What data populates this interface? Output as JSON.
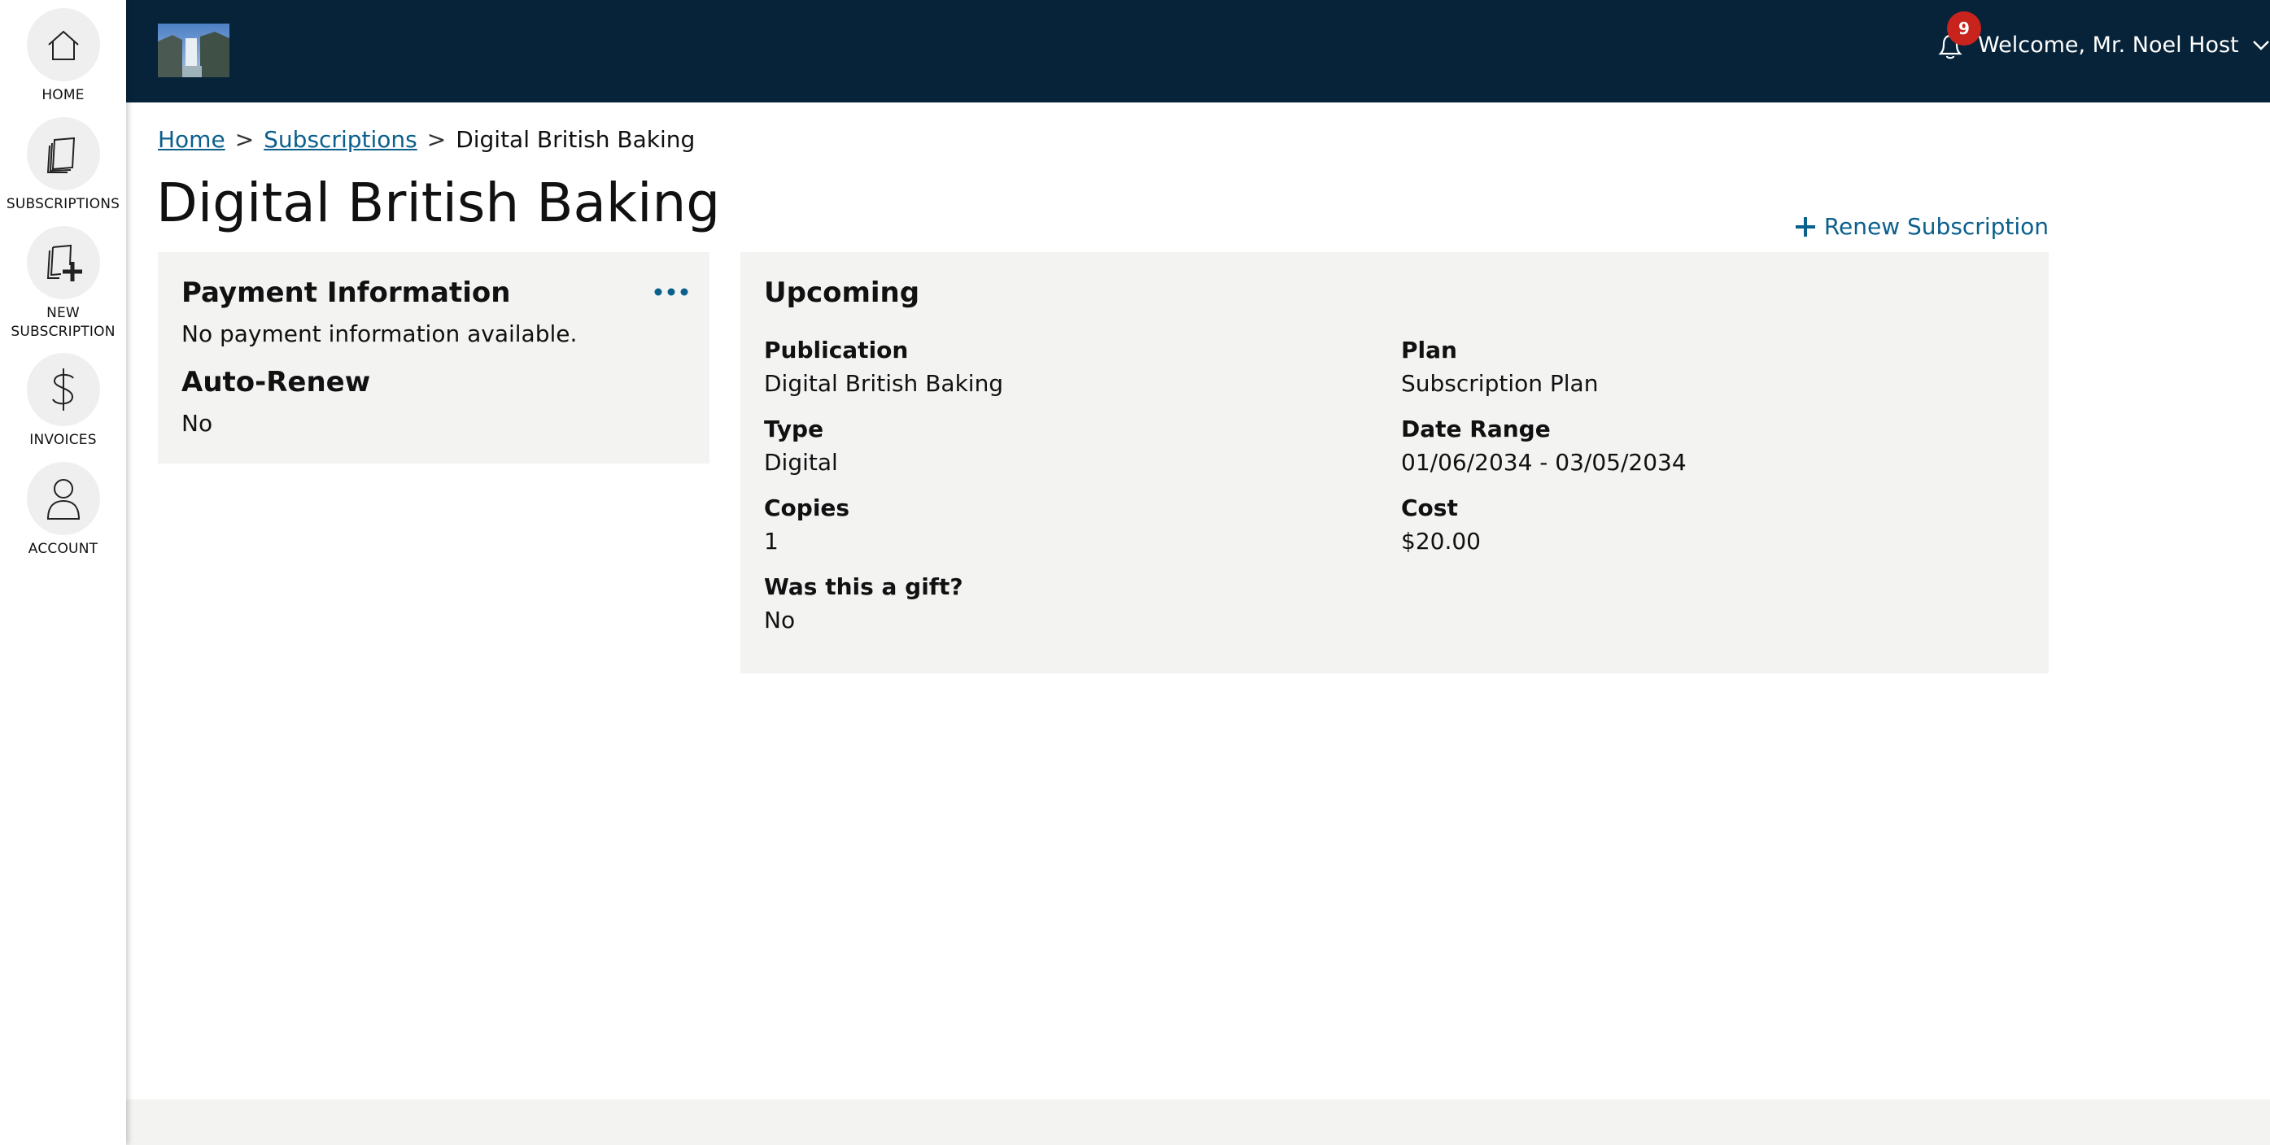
{
  "sidebar": {
    "items": [
      {
        "label": "HOME",
        "icon": "home-icon"
      },
      {
        "label": "SUBSCRIPTIONS",
        "icon": "subscriptions-icon"
      },
      {
        "label": "NEW SUBSCRIPTION",
        "icon": "new-subscription-icon"
      },
      {
        "label": "INVOICES",
        "icon": "dollar-icon"
      },
      {
        "label": "ACCOUNT",
        "icon": "user-icon"
      }
    ]
  },
  "header": {
    "notification_count": "9",
    "welcome": "Welcome, Mr. Noel Host",
    "background_color": "#072339"
  },
  "breadcrumb": {
    "home": "Home",
    "subscriptions": "Subscriptions",
    "current": "Digital British Baking",
    "separator": ">"
  },
  "page": {
    "title": "Digital British Baking",
    "renew_label": "Renew Subscription",
    "accent_color": "#0b5f8c"
  },
  "payment_card": {
    "title": "Payment Information",
    "message": "No payment information available.",
    "auto_renew_title": "Auto-Renew",
    "auto_renew_value": "No"
  },
  "upcoming_card": {
    "title": "Upcoming",
    "fields": {
      "publication": {
        "label": "Publication",
        "value": "Digital British Baking"
      },
      "plan": {
        "label": "Plan",
        "value": "Subscription Plan"
      },
      "type": {
        "label": "Type",
        "value": "Digital"
      },
      "date_range": {
        "label": "Date Range",
        "value": "01/06/2034 - 03/05/2034"
      },
      "copies": {
        "label": "Copies",
        "value": "1"
      },
      "cost": {
        "label": "Cost",
        "value": "$20.00"
      },
      "gift": {
        "label": "Was this a gift?",
        "value": "No"
      }
    }
  }
}
